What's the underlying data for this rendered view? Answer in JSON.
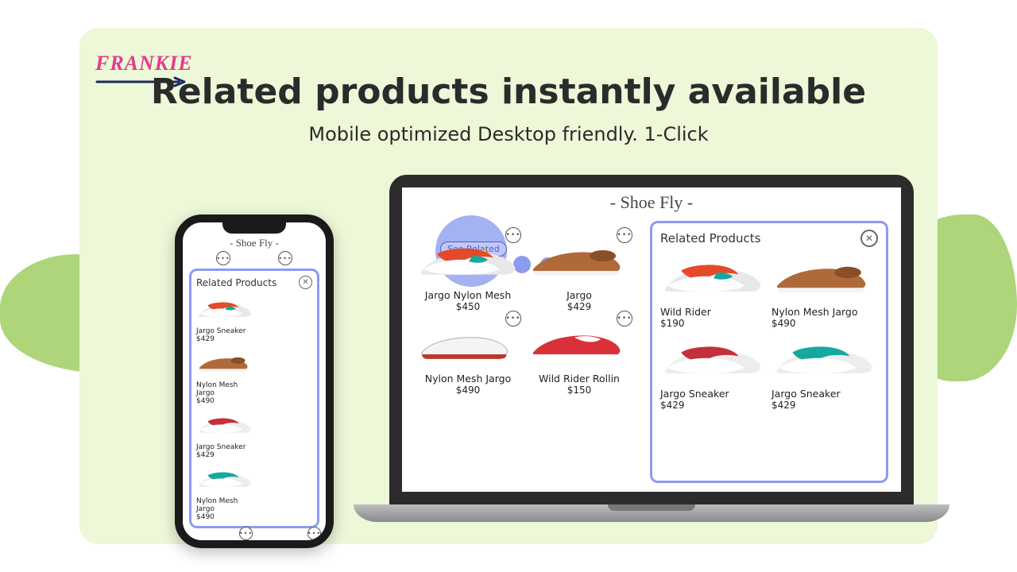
{
  "logo_text": "FRANKIE",
  "headline": "Related products instantly available",
  "subhead": "Mobile optimized Desktop friendly. 1-Click",
  "see_related_label": "See Related",
  "related_panel_title": "Related Products",
  "store_name": "- Shoe Fly -",
  "laptop": {
    "grid": [
      {
        "name": "Jargo Nylon Mesh",
        "price": "$450",
        "svg": "orangeTeal"
      },
      {
        "name": "Jargo",
        "price": "$429",
        "svg": "brownLow"
      },
      {
        "name": "Nylon Mesh Jargo",
        "price": "$490",
        "svg": "whiteCanvas"
      },
      {
        "name": "Wild Rider Rollin",
        "price": "$150",
        "svg": "redRunner"
      }
    ],
    "related": [
      {
        "name": "Wild Rider",
        "price": "$190",
        "svg": "orangeTeal"
      },
      {
        "name": "Nylon Mesh Jargo",
        "price": "$490",
        "svg": "brownLow"
      },
      {
        "name": "Jargo Sneaker",
        "price": "$429",
        "svg": "redWhite"
      },
      {
        "name": "Jargo Sneaker",
        "price": "$429",
        "svg": "tealWhite"
      }
    ]
  },
  "phone": {
    "related": [
      {
        "name": "Jargo Sneaker",
        "price": "$429",
        "svg": "orangeTeal"
      },
      {
        "name": "Nylon Mesh Jargo",
        "price": "$490",
        "svg": "brownLow"
      },
      {
        "name": "Jargo Sneaker",
        "price": "$429",
        "svg": "redWhite"
      },
      {
        "name": "Nylon Mesh Jargo",
        "price": "$490",
        "svg": "tealWhite"
      }
    ],
    "below": [
      {
        "svg": "redSuede"
      },
      {
        "svg": "tanLow"
      }
    ]
  }
}
